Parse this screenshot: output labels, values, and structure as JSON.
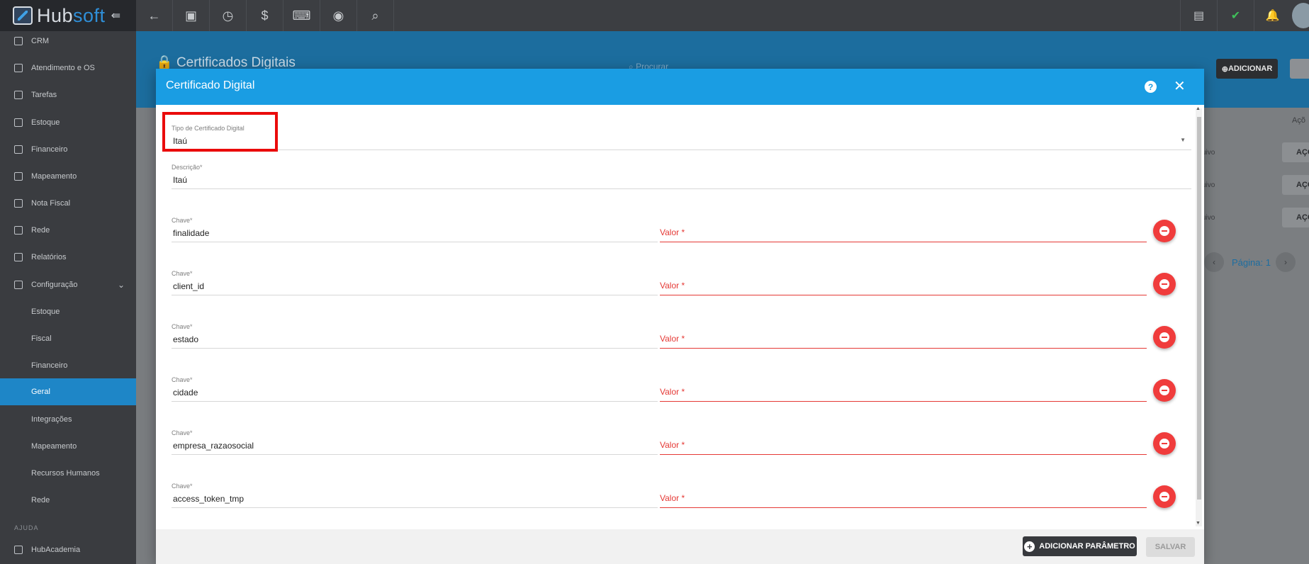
{
  "brand": {
    "name_part1": "Hub",
    "name_part2": "soft",
    "collapse_glyph": "⇚"
  },
  "toolbar": {
    "icons": [
      "back-arrow-icon",
      "contact-card-icon",
      "calendar-clock-icon",
      "dollar-icon",
      "terminal-icon",
      "eye-icon",
      "search-icon"
    ],
    "glyphs": [
      "←",
      "▣",
      "◷",
      "$",
      "⌨",
      "◉",
      "⌕"
    ],
    "right_icons": [
      "pdf-icon",
      "check-badge-icon",
      "bell-icon"
    ],
    "right_glyphs": [
      "▤",
      "✔",
      "🔔"
    ]
  },
  "sidebar": {
    "items": [
      {
        "label": "CRM"
      },
      {
        "label": "Atendimento e OS"
      },
      {
        "label": "Tarefas"
      },
      {
        "label": "Estoque"
      },
      {
        "label": "Financeiro"
      },
      {
        "label": "Mapeamento"
      },
      {
        "label": "Nota Fiscal"
      },
      {
        "label": "Rede"
      },
      {
        "label": "Relatórios"
      },
      {
        "label": "Configuração"
      }
    ],
    "sub_items": [
      {
        "label": "Estoque"
      },
      {
        "label": "Fiscal"
      },
      {
        "label": "Financeiro"
      },
      {
        "label": "Geral"
      },
      {
        "label": "Integrações"
      },
      {
        "label": "Mapeamento"
      },
      {
        "label": "Recursos Humanos"
      },
      {
        "label": "Rede"
      }
    ],
    "active_sub": "Geral",
    "help_section": "AJUDA",
    "help_item": "HubAcademia"
  },
  "background": {
    "page_title": "Certificados Digitais",
    "search_placeholder": "Procurar",
    "add_button": "ADICIONAR",
    "actions_header": "Açõ",
    "row_status": [
      "uivo",
      "uivo",
      "uivo"
    ],
    "row_action": "AÇÕ",
    "pager": "Página: 1"
  },
  "modal": {
    "title": "Certificado Digital",
    "tipo": {
      "label": "Tipo de Certificado Digital",
      "value": "Itaú"
    },
    "descricao": {
      "label": "Descrição",
      "value": "Itaú"
    },
    "required_mark": "*",
    "chave_label": "Chave",
    "valor_label": "Valor",
    "params": [
      {
        "chave": "finalidade",
        "valor": ""
      },
      {
        "chave": "client_id",
        "valor": ""
      },
      {
        "chave": "estado",
        "valor": ""
      },
      {
        "chave": "cidade",
        "valor": ""
      },
      {
        "chave": "empresa_razaosocial",
        "valor": ""
      },
      {
        "chave": "access_token_tmp",
        "valor": ""
      }
    ],
    "add_param_button": "ADICIONAR PARÂMETRO",
    "save_button": "SALVAR"
  },
  "colors": {
    "accent": "#1a9de3",
    "error": "#e53935",
    "active_nav": "#1e86c7"
  }
}
